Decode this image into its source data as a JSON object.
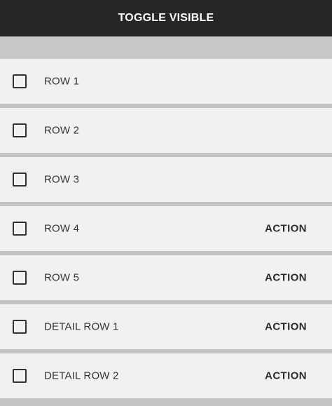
{
  "toolbar": {
    "toggle_label": "TOGGLE VISIBLE"
  },
  "rows": [
    {
      "label": "ROW 1",
      "action": ""
    },
    {
      "label": "ROW 2",
      "action": ""
    },
    {
      "label": "ROW 3",
      "action": ""
    },
    {
      "label": "ROW 4",
      "action": "ACTION"
    },
    {
      "label": "ROW 5",
      "action": "ACTION"
    },
    {
      "label": "DETAIL ROW 1",
      "action": "ACTION"
    },
    {
      "label": "DETAIL ROW 2",
      "action": "ACTION"
    }
  ],
  "colors": {
    "top_bar": "#262626",
    "row_background": "#f1f1f1",
    "separator": "#c3c3c1"
  }
}
